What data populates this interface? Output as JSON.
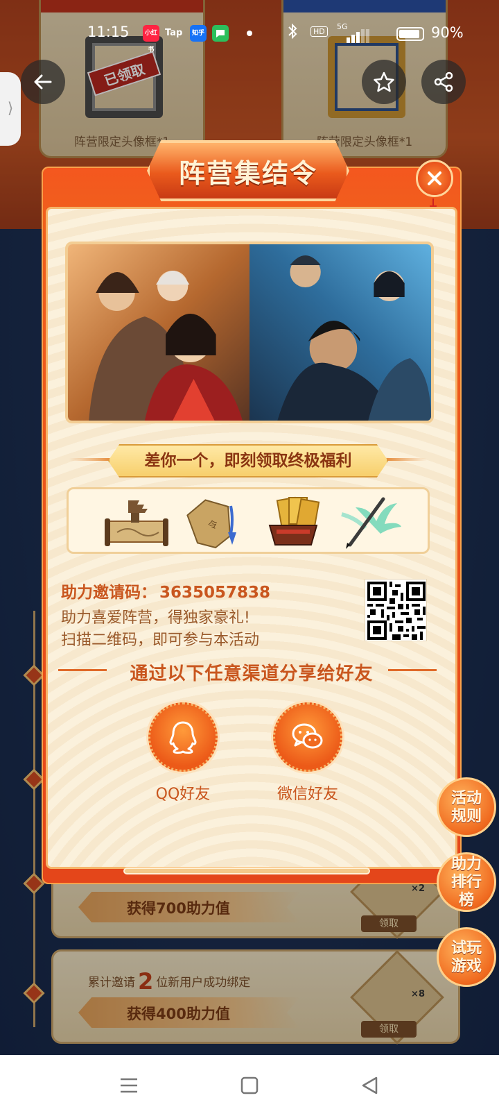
{
  "status_bar": {
    "time": "11:15",
    "apps": [
      {
        "name": "小红书",
        "color": "#ff2442"
      },
      {
        "name": "Tap",
        "color": "#14c2b0"
      },
      {
        "name": "知乎",
        "color": "#1772f6"
      },
      {
        "name": "messages",
        "color": "#2cbf5c"
      }
    ],
    "network_label": "HD",
    "signal_label": "5G",
    "battery_percent": "90%",
    "battery_level": 0.9
  },
  "nav": {
    "back_icon": "arrow-left-icon",
    "favorite_icon": "star-icon",
    "share_icon": "share-icon",
    "side_tab_glyph": "⟩"
  },
  "background": {
    "reward_cards": [
      {
        "caption": "阵营限定头像框*1",
        "claimed_label": "已领取",
        "claimed": true
      },
      {
        "caption": "阵营限定头像框*1",
        "claimed": false
      }
    ],
    "tasks": [
      {
        "desc_prefix": "",
        "count": "",
        "desc_suffix": "",
        "reward": "获得700助力值",
        "item_count": "×2",
        "claim_label": "领取"
      },
      {
        "desc_prefix": "累计邀请",
        "count": "2",
        "desc_suffix": "位新用户成功绑定",
        "reward": "获得400助力值",
        "item_count": "×8",
        "claim_label": "领取"
      }
    ]
  },
  "modal": {
    "title": "阵营集结令",
    "close_icon": "close-icon",
    "banner": "差你一个，即刻领取终极福利",
    "reward_items": [
      "pagoda-scroll-icon",
      "jade-token-icon",
      "gold-cards-chest-icon",
      "phoenix-brush-icon"
    ],
    "invite_label": "助力邀请码：",
    "invite_code": "3635057838",
    "invite_lines": [
      "助力喜爱阵营，得独家豪礼!",
      "扫描二维码，即可参与本活动"
    ],
    "share_title": "通过以下任意渠道分享给好友",
    "share_buttons": [
      {
        "label": "QQ好友",
        "icon": "qq-penguin-icon"
      },
      {
        "label": "微信好友",
        "icon": "wechat-icon"
      }
    ]
  },
  "side_buttons": [
    {
      "label": "活动规则"
    },
    {
      "label": "助力排行榜"
    },
    {
      "label": "试玩游戏"
    }
  ],
  "system_nav": {
    "menu_icon": "menu-icon",
    "home_icon": "home-square-icon",
    "back_icon": "back-triangle-icon"
  }
}
